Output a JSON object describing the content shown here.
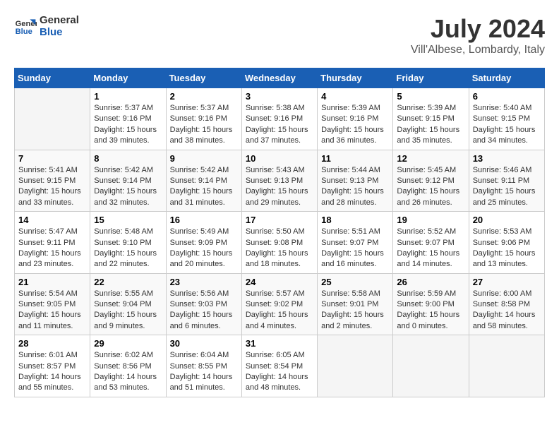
{
  "header": {
    "logo_line1": "General",
    "logo_line2": "Blue",
    "month": "July 2024",
    "location": "Vill'Albese, Lombardy, Italy"
  },
  "weekdays": [
    "Sunday",
    "Monday",
    "Tuesday",
    "Wednesday",
    "Thursday",
    "Friday",
    "Saturday"
  ],
  "weeks": [
    [
      {
        "day": "",
        "info": ""
      },
      {
        "day": "1",
        "info": "Sunrise: 5:37 AM\nSunset: 9:16 PM\nDaylight: 15 hours\nand 39 minutes."
      },
      {
        "day": "2",
        "info": "Sunrise: 5:37 AM\nSunset: 9:16 PM\nDaylight: 15 hours\nand 38 minutes."
      },
      {
        "day": "3",
        "info": "Sunrise: 5:38 AM\nSunset: 9:16 PM\nDaylight: 15 hours\nand 37 minutes."
      },
      {
        "day": "4",
        "info": "Sunrise: 5:39 AM\nSunset: 9:16 PM\nDaylight: 15 hours\nand 36 minutes."
      },
      {
        "day": "5",
        "info": "Sunrise: 5:39 AM\nSunset: 9:15 PM\nDaylight: 15 hours\nand 35 minutes."
      },
      {
        "day": "6",
        "info": "Sunrise: 5:40 AM\nSunset: 9:15 PM\nDaylight: 15 hours\nand 34 minutes."
      }
    ],
    [
      {
        "day": "7",
        "info": "Sunrise: 5:41 AM\nSunset: 9:15 PM\nDaylight: 15 hours\nand 33 minutes."
      },
      {
        "day": "8",
        "info": "Sunrise: 5:42 AM\nSunset: 9:14 PM\nDaylight: 15 hours\nand 32 minutes."
      },
      {
        "day": "9",
        "info": "Sunrise: 5:42 AM\nSunset: 9:14 PM\nDaylight: 15 hours\nand 31 minutes."
      },
      {
        "day": "10",
        "info": "Sunrise: 5:43 AM\nSunset: 9:13 PM\nDaylight: 15 hours\nand 29 minutes."
      },
      {
        "day": "11",
        "info": "Sunrise: 5:44 AM\nSunset: 9:13 PM\nDaylight: 15 hours\nand 28 minutes."
      },
      {
        "day": "12",
        "info": "Sunrise: 5:45 AM\nSunset: 9:12 PM\nDaylight: 15 hours\nand 26 minutes."
      },
      {
        "day": "13",
        "info": "Sunrise: 5:46 AM\nSunset: 9:11 PM\nDaylight: 15 hours\nand 25 minutes."
      }
    ],
    [
      {
        "day": "14",
        "info": "Sunrise: 5:47 AM\nSunset: 9:11 PM\nDaylight: 15 hours\nand 23 minutes."
      },
      {
        "day": "15",
        "info": "Sunrise: 5:48 AM\nSunset: 9:10 PM\nDaylight: 15 hours\nand 22 minutes."
      },
      {
        "day": "16",
        "info": "Sunrise: 5:49 AM\nSunset: 9:09 PM\nDaylight: 15 hours\nand 20 minutes."
      },
      {
        "day": "17",
        "info": "Sunrise: 5:50 AM\nSunset: 9:08 PM\nDaylight: 15 hours\nand 18 minutes."
      },
      {
        "day": "18",
        "info": "Sunrise: 5:51 AM\nSunset: 9:07 PM\nDaylight: 15 hours\nand 16 minutes."
      },
      {
        "day": "19",
        "info": "Sunrise: 5:52 AM\nSunset: 9:07 PM\nDaylight: 15 hours\nand 14 minutes."
      },
      {
        "day": "20",
        "info": "Sunrise: 5:53 AM\nSunset: 9:06 PM\nDaylight: 15 hours\nand 13 minutes."
      }
    ],
    [
      {
        "day": "21",
        "info": "Sunrise: 5:54 AM\nSunset: 9:05 PM\nDaylight: 15 hours\nand 11 minutes."
      },
      {
        "day": "22",
        "info": "Sunrise: 5:55 AM\nSunset: 9:04 PM\nDaylight: 15 hours\nand 9 minutes."
      },
      {
        "day": "23",
        "info": "Sunrise: 5:56 AM\nSunset: 9:03 PM\nDaylight: 15 hours\nand 6 minutes."
      },
      {
        "day": "24",
        "info": "Sunrise: 5:57 AM\nSunset: 9:02 PM\nDaylight: 15 hours\nand 4 minutes."
      },
      {
        "day": "25",
        "info": "Sunrise: 5:58 AM\nSunset: 9:01 PM\nDaylight: 15 hours\nand 2 minutes."
      },
      {
        "day": "26",
        "info": "Sunrise: 5:59 AM\nSunset: 9:00 PM\nDaylight: 15 hours\nand 0 minutes."
      },
      {
        "day": "27",
        "info": "Sunrise: 6:00 AM\nSunset: 8:58 PM\nDaylight: 14 hours\nand 58 minutes."
      }
    ],
    [
      {
        "day": "28",
        "info": "Sunrise: 6:01 AM\nSunset: 8:57 PM\nDaylight: 14 hours\nand 55 minutes."
      },
      {
        "day": "29",
        "info": "Sunrise: 6:02 AM\nSunset: 8:56 PM\nDaylight: 14 hours\nand 53 minutes."
      },
      {
        "day": "30",
        "info": "Sunrise: 6:04 AM\nSunset: 8:55 PM\nDaylight: 14 hours\nand 51 minutes."
      },
      {
        "day": "31",
        "info": "Sunrise: 6:05 AM\nSunset: 8:54 PM\nDaylight: 14 hours\nand 48 minutes."
      },
      {
        "day": "",
        "info": ""
      },
      {
        "day": "",
        "info": ""
      },
      {
        "day": "",
        "info": ""
      }
    ]
  ]
}
